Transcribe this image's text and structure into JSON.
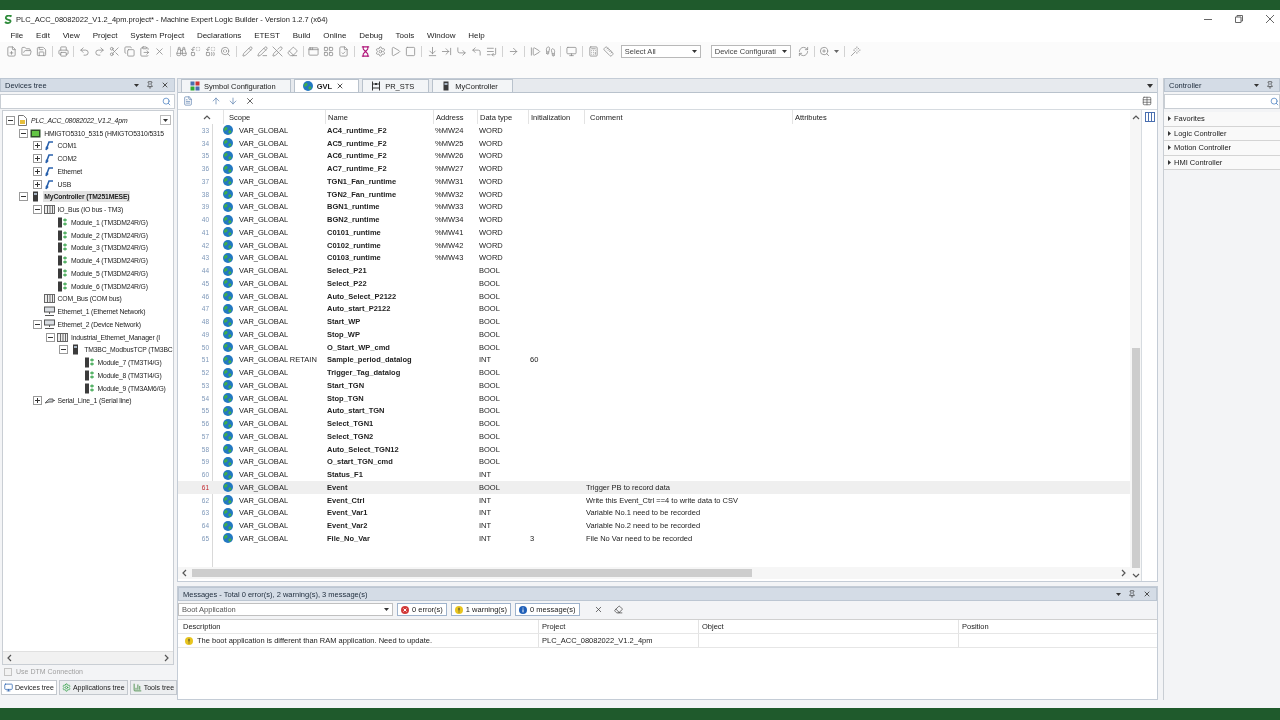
{
  "window": {
    "title": "PLC_ACC_08082022_V1.2_4pm.project* - Machine Expert Logic Builder - Version 1.2.7 (x64)"
  },
  "menu": [
    "File",
    "Edit",
    "View",
    "Project",
    "System Project",
    "Declarations",
    "ETEST",
    "Build",
    "Online",
    "Debug",
    "Tools",
    "Window",
    "Help"
  ],
  "toolbar": {
    "dropdowns": [
      "Select All",
      "Device Configurati"
    ]
  },
  "devices_panel": {
    "title": "Devices tree",
    "tree": [
      {
        "label": "PLC_ACC_08082022_V1.2_4pm",
        "kind": "project",
        "expanded": true,
        "selected": false,
        "children": [
          {
            "label": "HMIGTO5310_5315 (HMIGTO5310/5315",
            "kind": "hmi",
            "expanded": true,
            "selected": false,
            "children": [
              {
                "label": "COM1",
                "kind": "port",
                "expanded": false,
                "selected": false
              },
              {
                "label": "COM2",
                "kind": "port",
                "expanded": false,
                "selected": false
              },
              {
                "label": "Ethernet",
                "kind": "port",
                "expanded": false,
                "selected": false
              },
              {
                "label": "USB",
                "kind": "port",
                "expanded": false,
                "selected": false
              }
            ]
          },
          {
            "label": "MyController (TM251MESE)",
            "kind": "controller",
            "expanded": true,
            "selected": true,
            "children": [
              {
                "label": "IO_Bus (IO bus - TM3)",
                "kind": "bus",
                "expanded": true,
                "selected": false,
                "children": [
                  {
                    "label": "Module_1 (TM3DM24R/G)",
                    "kind": "module",
                    "selected": false
                  },
                  {
                    "label": "Module_2 (TM3DM24R/G)",
                    "kind": "module",
                    "selected": false
                  },
                  {
                    "label": "Module_3 (TM3DM24R/G)",
                    "kind": "module",
                    "selected": false
                  },
                  {
                    "label": "Module_4 (TM3DM24R/G)",
                    "kind": "module",
                    "selected": false
                  },
                  {
                    "label": "Module_5 (TM3DM24R/G)",
                    "kind": "module",
                    "selected": false
                  },
                  {
                    "label": "Module_6 (TM3DM24R/G)",
                    "kind": "module",
                    "selected": false
                  }
                ]
              },
              {
                "label": "COM_Bus (COM bus)",
                "kind": "bus",
                "selected": false
              },
              {
                "label": "Ethernet_1 (Ethernet Network)",
                "kind": "network",
                "selected": false
              },
              {
                "label": "Ethernet_2 (Device Network)",
                "kind": "network",
                "expanded": true,
                "selected": false,
                "children": [
                  {
                    "label": "Industrial_Ethernet_Manager (I",
                    "kind": "bus",
                    "expanded": true,
                    "selected": false,
                    "children": [
                      {
                        "label": "TM3BC_ModbusTCP (TM3BC",
                        "kind": "controller",
                        "expanded": true,
                        "selected": false,
                        "children": [
                          {
                            "label": "Module_7 (TM3TI4/G)",
                            "kind": "module",
                            "selected": false
                          },
                          {
                            "label": "Module_8 (TM3TI4/G)",
                            "kind": "module",
                            "selected": false
                          },
                          {
                            "label": "Module_9 (TM3AM6/G)",
                            "kind": "module",
                            "selected": false
                          }
                        ]
                      }
                    ]
                  }
                ]
              },
              {
                "label": "Serial_Line_1 (Serial line)",
                "kind": "serial",
                "expanded": false,
                "selected": false
              }
            ]
          }
        ]
      }
    ],
    "option": {
      "label": "Use DTM Connection",
      "checked": false,
      "disabled": true
    },
    "tabs": [
      {
        "label": "Devices tree",
        "kind": "devices",
        "selected": true
      },
      {
        "label": "Applications tree",
        "kind": "applications",
        "selected": false
      },
      {
        "label": "Tools tree",
        "kind": "tools",
        "selected": false
      }
    ]
  },
  "editor": {
    "tabs": [
      {
        "label": "Symbol Configuration",
        "kind": "symbols",
        "selected": false
      },
      {
        "label": "GVL",
        "kind": "globals",
        "selected": true
      },
      {
        "label": "PR_STS",
        "kind": "program",
        "selected": false
      },
      {
        "label": "MyController",
        "kind": "device",
        "selected": false
      }
    ],
    "table": {
      "columns": [
        "Scope",
        "Name",
        "Address",
        "Data type",
        "Initialization",
        "Comment",
        "Attributes"
      ],
      "rows": [
        {
          "line": "33",
          "scope": "VAR_GLOBAL",
          "name": "AC4_runtime_F2",
          "address": "%MW24",
          "data_type": "WORD",
          "selected": false
        },
        {
          "line": "34",
          "scope": "VAR_GLOBAL",
          "name": "AC5_runtime_F2",
          "address": "%MW25",
          "data_type": "WORD",
          "selected": false
        },
        {
          "line": "35",
          "scope": "VAR_GLOBAL",
          "name": "AC6_runtime_F2",
          "address": "%MW26",
          "data_type": "WORD",
          "selected": false
        },
        {
          "line": "36",
          "scope": "VAR_GLOBAL",
          "name": "AC7_runtime_F2",
          "address": "%MW27",
          "data_type": "WORD",
          "selected": false
        },
        {
          "line": "37",
          "scope": "VAR_GLOBAL",
          "name": "TGN1_Fan_runtime",
          "address": "%MW31",
          "data_type": "WORD",
          "selected": false
        },
        {
          "line": "38",
          "scope": "VAR_GLOBAL",
          "name": "TGN2_Fan_runtime",
          "address": "%MW32",
          "data_type": "WORD",
          "selected": false
        },
        {
          "line": "39",
          "scope": "VAR_GLOBAL",
          "name": "BGN1_runtime",
          "address": "%MW33",
          "data_type": "WORD",
          "selected": false
        },
        {
          "line": "40",
          "scope": "VAR_GLOBAL",
          "name": "BGN2_runtime",
          "address": "%MW34",
          "data_type": "WORD",
          "selected": false
        },
        {
          "line": "41",
          "scope": "VAR_GLOBAL",
          "name": "C0101_runtime",
          "address": "%MW41",
          "data_type": "WORD",
          "selected": false
        },
        {
          "line": "42",
          "scope": "VAR_GLOBAL",
          "name": "C0102_runtime",
          "address": "%MW42",
          "data_type": "WORD",
          "selected": false
        },
        {
          "line": "43",
          "scope": "VAR_GLOBAL",
          "name": "C0103_runtime",
          "address": "%MW43",
          "data_type": "WORD",
          "selected": false
        },
        {
          "line": "44",
          "scope": "VAR_GLOBAL",
          "name": "Select_P21",
          "data_type": "BOOL",
          "selected": false
        },
        {
          "line": "45",
          "scope": "VAR_GLOBAL",
          "name": "Select_P22",
          "data_type": "BOOL",
          "selected": false
        },
        {
          "line": "46",
          "scope": "VAR_GLOBAL",
          "name": "Auto_Select_P2122",
          "data_type": "BOOL",
          "selected": false
        },
        {
          "line": "47",
          "scope": "VAR_GLOBAL",
          "name": "Auto_start_P2122",
          "data_type": "BOOL",
          "selected": false
        },
        {
          "line": "48",
          "scope": "VAR_GLOBAL",
          "name": "Start_WP",
          "data_type": "BOOL",
          "selected": false
        },
        {
          "line": "49",
          "scope": "VAR_GLOBAL",
          "name": "Stop_WP",
          "data_type": "BOOL",
          "selected": false
        },
        {
          "line": "50",
          "scope": "VAR_GLOBAL",
          "name": "O_Start_WP_cmd",
          "data_type": "BOOL",
          "selected": false
        },
        {
          "line": "51",
          "scope": "VAR_GLOBAL RETAIN",
          "name": "Sample_period_datalog",
          "data_type": "INT",
          "initialization": "60",
          "selected": false
        },
        {
          "line": "52",
          "scope": "VAR_GLOBAL",
          "name": "Trigger_Tag_datalog",
          "data_type": "BOOL",
          "selected": false
        },
        {
          "line": "53",
          "scope": "VAR_GLOBAL",
          "name": "Start_TGN",
          "data_type": "BOOL",
          "selected": false
        },
        {
          "line": "54",
          "scope": "VAR_GLOBAL",
          "name": "Stop_TGN",
          "data_type": "BOOL",
          "selected": false
        },
        {
          "line": "55",
          "scope": "VAR_GLOBAL",
          "name": "Auto_start_TGN",
          "data_type": "BOOL",
          "selected": false
        },
        {
          "line": "56",
          "scope": "VAR_GLOBAL",
          "name": "Select_TGN1",
          "data_type": "BOOL",
          "selected": false
        },
        {
          "line": "57",
          "scope": "VAR_GLOBAL",
          "name": "Select_TGN2",
          "data_type": "BOOL",
          "selected": false
        },
        {
          "line": "58",
          "scope": "VAR_GLOBAL",
          "name": "Auto_Select_TGN12",
          "data_type": "BOOL",
          "selected": false
        },
        {
          "line": "59",
          "scope": "VAR_GLOBAL",
          "name": "O_start_TGN_cmd",
          "data_type": "BOOL",
          "selected": false
        },
        {
          "line": "60",
          "scope": "VAR_GLOBAL",
          "name": "Status_F1",
          "data_type": "INT",
          "selected": false
        },
        {
          "line": "61",
          "scope": "VAR_GLOBAL",
          "name": "Event",
          "data_type": "BOOL",
          "comment": "Trigger PB to record data",
          "selected": true
        },
        {
          "line": "62",
          "scope": "VAR_GLOBAL",
          "name": "Event_Ctrl",
          "data_type": "INT",
          "comment": "Write this Event_Ctrl ==4 to write data to CSV",
          "selected": false
        },
        {
          "line": "63",
          "scope": "VAR_GLOBAL",
          "name": "Event_Var1",
          "data_type": "INT",
          "comment": "Variable No.1 need to be recorded",
          "selected": false
        },
        {
          "line": "64",
          "scope": "VAR_GLOBAL",
          "name": "Event_Var2",
          "data_type": "INT",
          "comment": "Variable No.2 need to be recorded",
          "selected": false
        },
        {
          "line": "65",
          "scope": "VAR_GLOBAL",
          "name": "File_No_Var",
          "data_type": "INT",
          "initialization": "3",
          "comment": "File No Var need to be recorded",
          "selected": false
        }
      ]
    }
  },
  "messages": {
    "title": "Messages - Total 0 error(s), 2 warning(s), 3 message(s)",
    "source": "Boot Application",
    "filters": [
      {
        "kind": "error",
        "label": "0 error(s)"
      },
      {
        "kind": "warning",
        "label": "1 warning(s)"
      },
      {
        "kind": "message",
        "label": "0 message(s)"
      }
    ],
    "columns": [
      "Description",
      "Project",
      "Object",
      "Position"
    ],
    "rows": [
      {
        "kind": "warning",
        "description": "The boot application is different than RAM application. Need to update.",
        "project": "PLC_ACC_08082022_V1.2_4pm"
      }
    ]
  },
  "controller_panel": {
    "title": "Controller",
    "sections": [
      {
        "label": "Favorites",
        "expanded": false
      },
      {
        "label": "Logic Controller",
        "expanded": false
      },
      {
        "label": "Motion Controller",
        "expanded": false
      },
      {
        "label": "HMI Controller",
        "expanded": false
      }
    ]
  }
}
